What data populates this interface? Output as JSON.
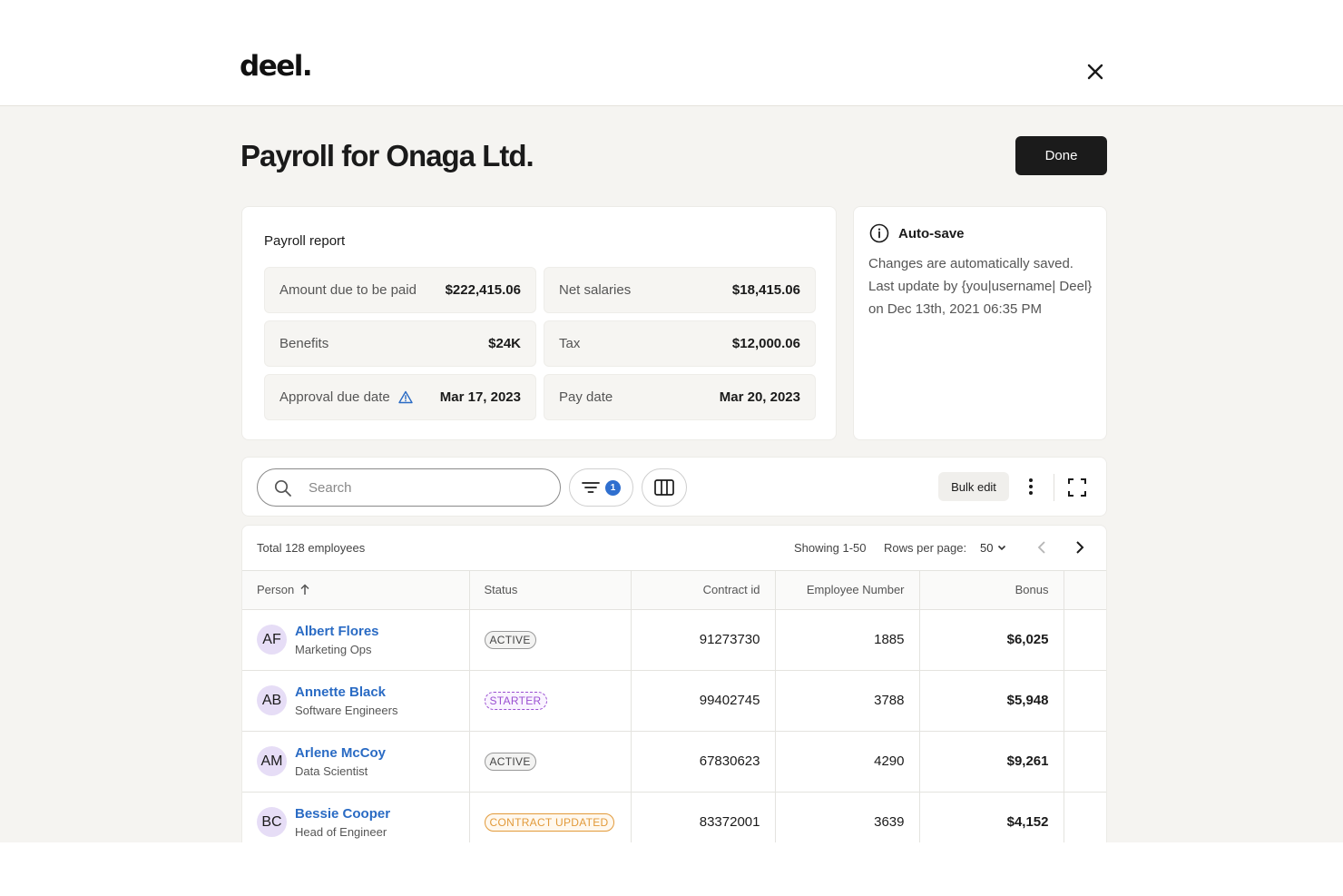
{
  "app": {
    "logo": "deel."
  },
  "page": {
    "title": "Payroll for Onaga Ltd.",
    "done_label": "Done"
  },
  "report": {
    "title": "Payroll report",
    "stats": [
      {
        "label": "Amount due to be paid",
        "value": "$222,415.06"
      },
      {
        "label": "Net salaries",
        "value": "$18,415.06"
      },
      {
        "label": "Benefits",
        "value": "$24K"
      },
      {
        "label": "Tax",
        "value": "$12,000.06"
      },
      {
        "label": "Approval due date",
        "value": "Mar 17, 2023",
        "icon": "warning-icon"
      },
      {
        "label": "Pay date",
        "value": "Mar 20, 2023"
      }
    ]
  },
  "autosave": {
    "title": "Auto-save",
    "text": "Changes are automatically saved. Last update by {you|username| Deel} on Dec 13th, 2021 06:35 PM"
  },
  "toolbar": {
    "search_placeholder": "Search",
    "filter_count": "1",
    "bulk_edit_label": "Bulk edit"
  },
  "table": {
    "total": "Total 128 employees",
    "showing": "Showing 1-50",
    "rows_per_page_label": "Rows per page:",
    "rows_per_page_value": "50",
    "columns": [
      "Person",
      "Status",
      "Contract id",
      "Employee Number",
      "Bonus"
    ],
    "rows": [
      {
        "initials": "AF",
        "name": "Albert Flores",
        "role": "Marketing Ops",
        "status": "ACTIVE",
        "status_type": "active",
        "contract_id": "91273730",
        "employee_number": "1885",
        "bonus": "$6,025"
      },
      {
        "initials": "AB",
        "name": "Annette Black",
        "role": "Software Engineers",
        "status": "STARTER",
        "status_type": "starter",
        "contract_id": "99402745",
        "employee_number": "3788",
        "bonus": "$5,948"
      },
      {
        "initials": "AM",
        "name": "Arlene McCoy",
        "role": "Data Scientist",
        "status": "ACTIVE",
        "status_type": "active",
        "contract_id": "67830623",
        "employee_number": "4290",
        "bonus": "$9,261"
      },
      {
        "initials": "BC",
        "name": "Bessie Cooper",
        "role": "Head of Engineer",
        "status": "CONTRACT UPDATED",
        "status_type": "updated",
        "contract_id": "83372001",
        "employee_number": "3639",
        "bonus": "$4,152"
      }
    ]
  },
  "colors": {
    "accent_blue": "#2a6bc4",
    "badge_blue": "#2f6fcf",
    "done_bg": "#1b1b1b",
    "page_bg": "#f5f4f1",
    "avatar_bg": "#e6ddf6",
    "starter": "#9a4fd1",
    "updated": "#e29a3a"
  }
}
